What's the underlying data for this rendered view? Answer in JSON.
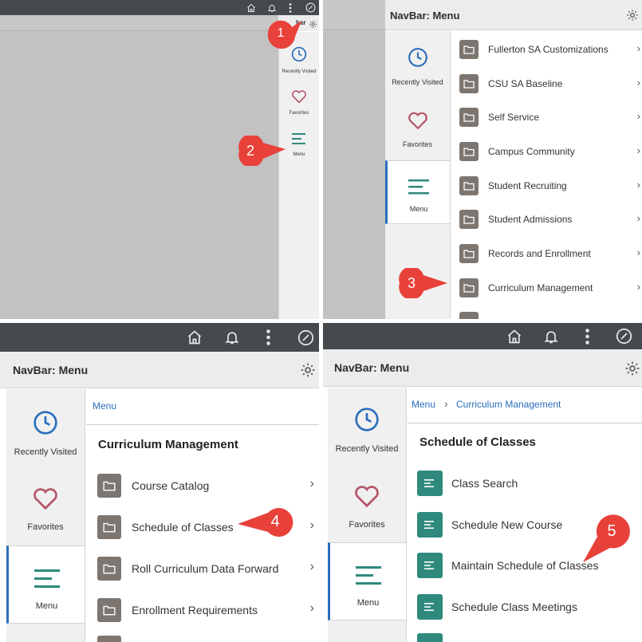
{
  "panel1": {
    "navhead_partial": "bar",
    "sidebar": [
      {
        "label": "Recently Visited",
        "icon": "clock-icon"
      },
      {
        "label": "Favorites",
        "icon": "heart-icon"
      },
      {
        "label": "Menu",
        "icon": "menu-lines-icon"
      }
    ],
    "callouts": [
      "1",
      "2"
    ]
  },
  "panel2": {
    "title": "NavBar: Menu",
    "sidebar": [
      {
        "label": "Recently Visited"
      },
      {
        "label": "Favorites"
      },
      {
        "label": "Menu"
      }
    ],
    "items": [
      "Fullerton SA Customizations",
      "CSU SA Baseline",
      "Self Service",
      "Campus Community",
      "Student Recruiting",
      "Student Admissions",
      "Records and Enrollment",
      "Curriculum Management"
    ],
    "callout": "3"
  },
  "panel3": {
    "title": "NavBar: Menu",
    "breadcrumb": "Menu",
    "section": "Curriculum Management",
    "sidebar": [
      {
        "label": "Recently Visited"
      },
      {
        "label": "Favorites"
      },
      {
        "label": "Menu"
      }
    ],
    "items": [
      "Course Catalog",
      "Schedule of Classes",
      "Roll Curriculum Data Forward",
      "Enrollment Requirements"
    ],
    "callout": "4"
  },
  "panel4": {
    "title": "NavBar: Menu",
    "breadcrumb": [
      "Menu",
      "Curriculum Management"
    ],
    "section": "Schedule of Classes",
    "sidebar": [
      {
        "label": "Recently Visited"
      },
      {
        "label": "Favorites"
      },
      {
        "label": "Menu"
      }
    ],
    "items": [
      "Class Search",
      "Schedule New Course",
      "Maintain Schedule of Classes",
      "Schedule Class Meetings"
    ],
    "callout": "5"
  },
  "colors": {
    "topbar": "#444a4e",
    "folder": "#7d7670",
    "component": "#2f8a7d",
    "callout": "#e8413a",
    "link": "#2a6ebb",
    "clock": "#2a6ebb",
    "heart": "#b5566a",
    "menu": "#2f8a7d"
  }
}
